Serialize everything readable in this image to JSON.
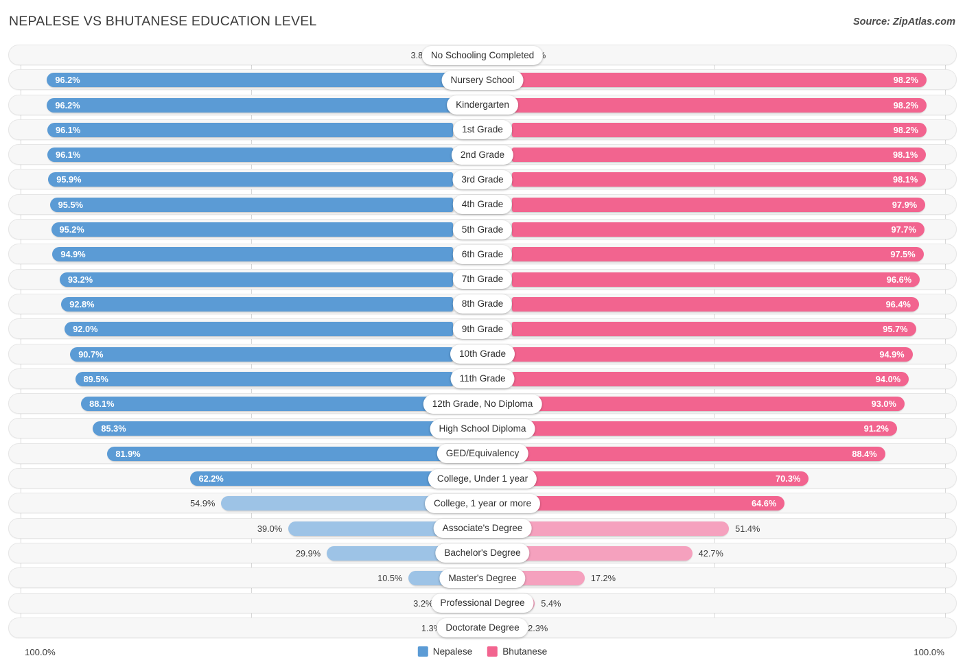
{
  "header": {
    "title": "NEPALESE VS BHUTANESE EDUCATION LEVEL",
    "source": "Source: ZipAtlas.com"
  },
  "footer": {
    "axis_min_label": "100.0%",
    "axis_max_label": "100.0%"
  },
  "colors": {
    "left_strong": "#5B9BD5",
    "left_light": "#9DC3E6",
    "right_strong": "#F2648F",
    "right_light": "#F5A1BE",
    "track": "#f7f7f7",
    "track_border": "#e6e6e6",
    "gridline": "#d8d8d8",
    "pill_bg": "#ffffff"
  },
  "chart_data": {
    "type": "bar",
    "subtype": "diverging-paired-bar",
    "title": "NEPALESE VS BHUTANESE EDUCATION LEVEL",
    "xlabel": "",
    "ylabel": "",
    "xlim": [
      0,
      100
    ],
    "unit": "%",
    "grid": true,
    "legend_position": "bottom-center",
    "legend": [
      {
        "name": "Nepalese",
        "color": "#5B9BD5"
      },
      {
        "name": "Bhutanese",
        "color": "#F2648F"
      }
    ],
    "categories": [
      "No Schooling Completed",
      "Nursery School",
      "Kindergarten",
      "1st Grade",
      "2nd Grade",
      "3rd Grade",
      "4th Grade",
      "5th Grade",
      "6th Grade",
      "7th Grade",
      "8th Grade",
      "9th Grade",
      "10th Grade",
      "11th Grade",
      "12th Grade, No Diploma",
      "High School Diploma",
      "GED/Equivalency",
      "College, Under 1 year",
      "College, 1 year or more",
      "Associate's Degree",
      "Bachelor's Degree",
      "Master's Degree",
      "Professional Degree",
      "Doctorate Degree"
    ],
    "series": [
      {
        "name": "Nepalese",
        "side": "left",
        "values": [
          3.8,
          96.2,
          96.2,
          96.1,
          96.1,
          95.9,
          95.5,
          95.2,
          94.9,
          93.2,
          92.8,
          92.0,
          90.7,
          89.5,
          88.1,
          85.3,
          81.9,
          62.2,
          54.9,
          39.0,
          29.9,
          10.5,
          3.2,
          1.3
        ],
        "labels": [
          "3.8%",
          "96.2%",
          "96.2%",
          "96.1%",
          "96.1%",
          "95.9%",
          "95.5%",
          "95.2%",
          "94.9%",
          "93.2%",
          "92.8%",
          "92.0%",
          "90.7%",
          "89.5%",
          "88.1%",
          "85.3%",
          "81.9%",
          "62.2%",
          "54.9%",
          "39.0%",
          "29.9%",
          "10.5%",
          "3.2%",
          "1.3%"
        ]
      },
      {
        "name": "Bhutanese",
        "side": "right",
        "values": [
          1.8,
          98.2,
          98.2,
          98.2,
          98.1,
          98.1,
          97.9,
          97.7,
          97.5,
          96.6,
          96.4,
          95.7,
          94.9,
          94.0,
          93.0,
          91.2,
          88.4,
          70.3,
          64.6,
          51.4,
          42.7,
          17.2,
          5.4,
          2.3
        ],
        "labels": [
          "1.8%",
          "98.2%",
          "98.2%",
          "98.2%",
          "98.1%",
          "98.1%",
          "97.9%",
          "97.7%",
          "97.5%",
          "96.6%",
          "96.4%",
          "95.7%",
          "94.9%",
          "94.0%",
          "93.0%",
          "91.2%",
          "88.4%",
          "70.3%",
          "64.6%",
          "51.4%",
          "42.7%",
          "17.2%",
          "5.4%",
          "2.3%"
        ]
      }
    ]
  }
}
